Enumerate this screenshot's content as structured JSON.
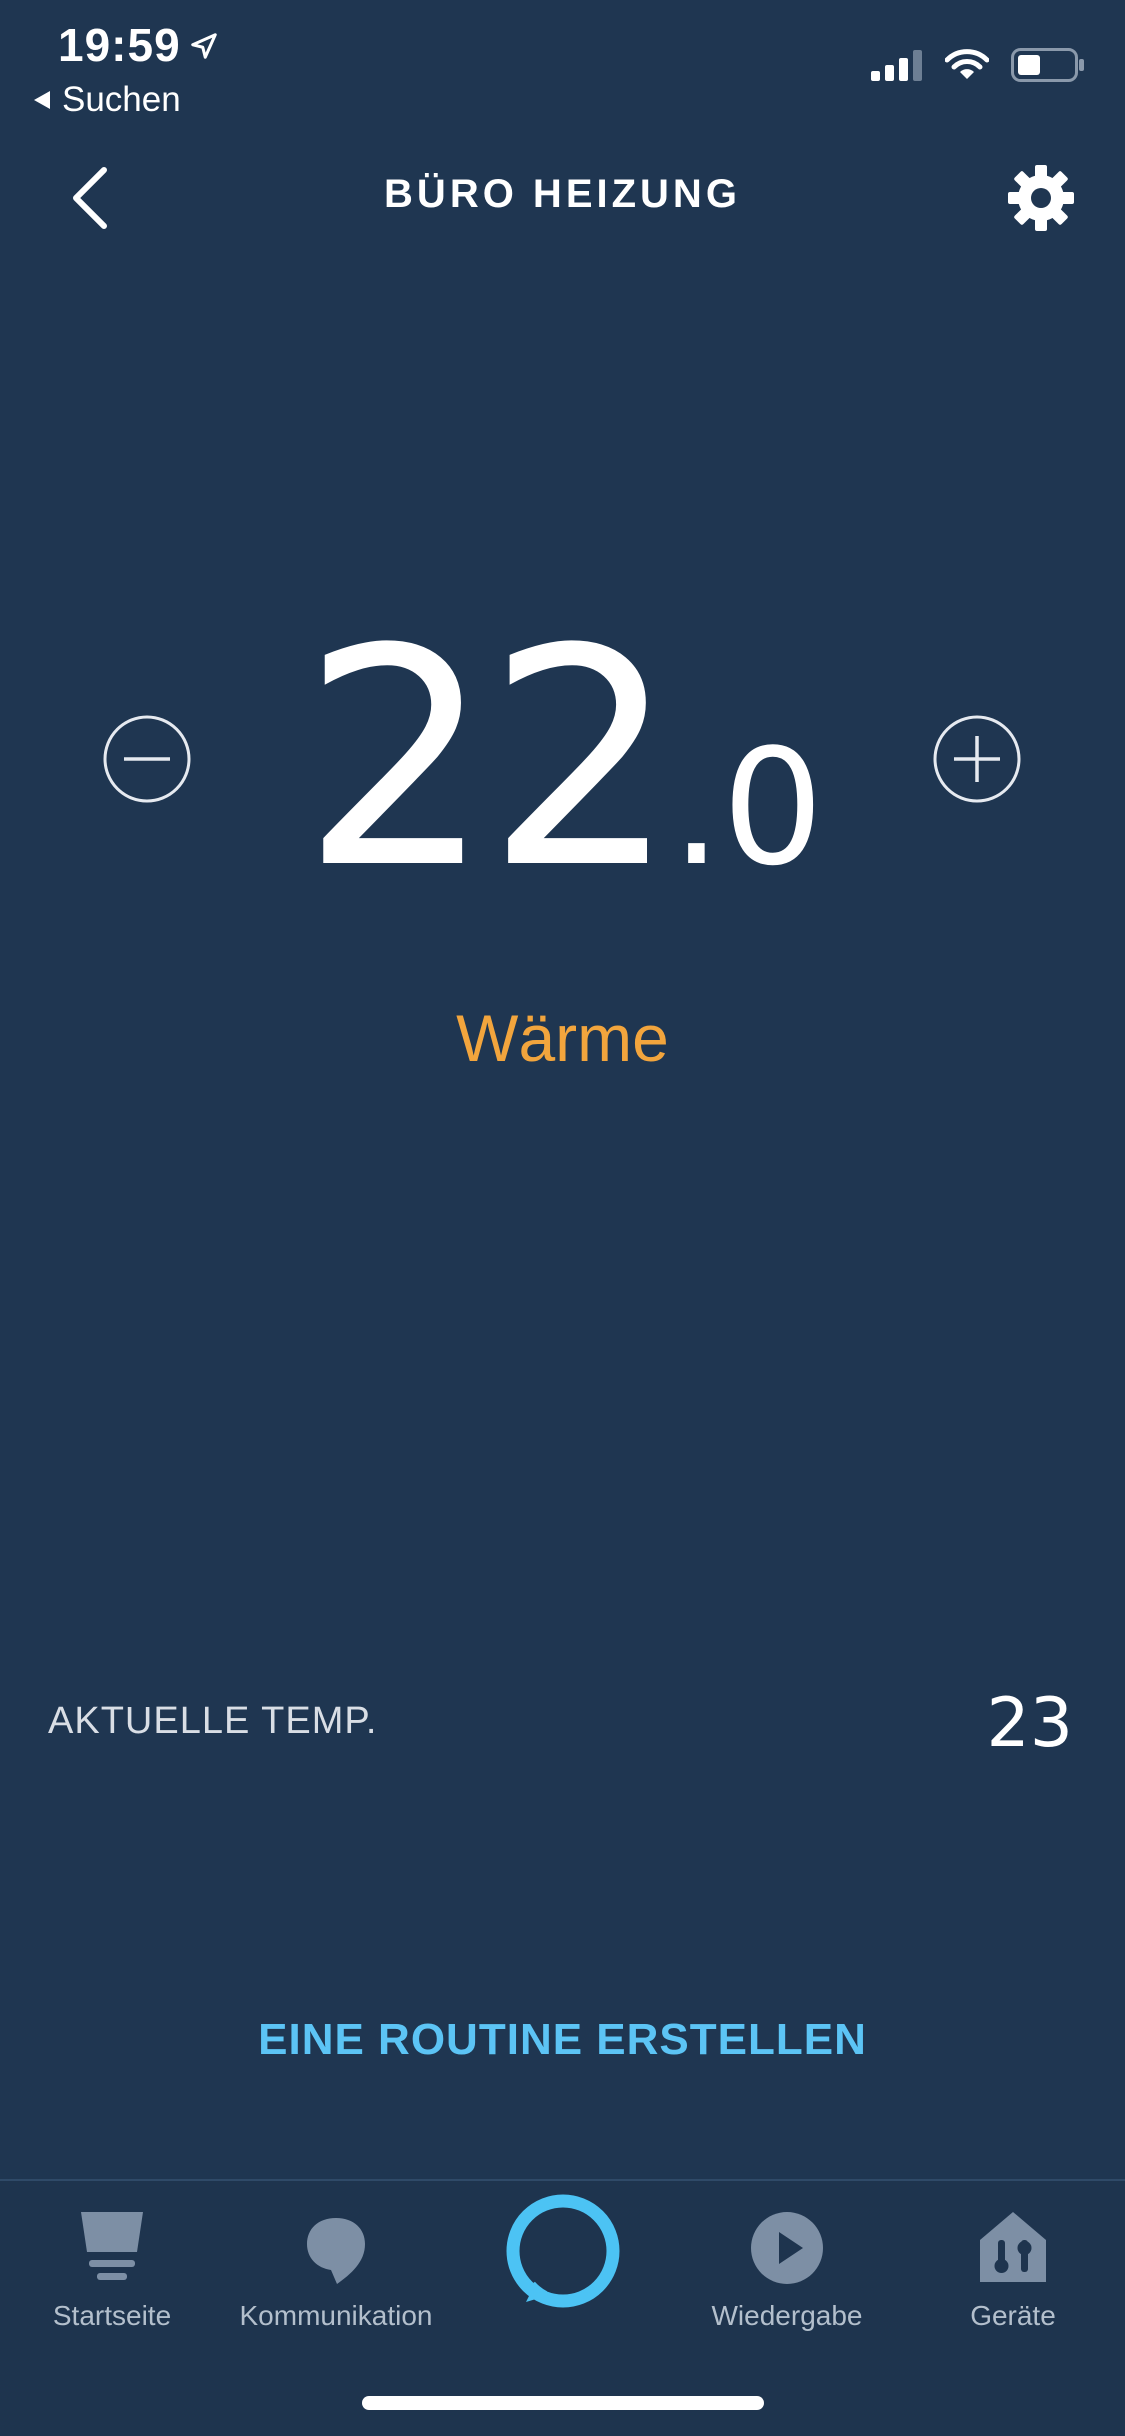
{
  "status_bar": {
    "time": "19:59",
    "back_app": "Suchen"
  },
  "header": {
    "title": "BÜRO HEIZUNG"
  },
  "thermostat": {
    "setpoint_integer": "22",
    "setpoint_decimal": ".0",
    "mode": "Wärme",
    "current_label": "AKTUELLE TEMP.",
    "current_value": "23"
  },
  "routine": {
    "label": "EINE ROUTINE ERSTELLEN"
  },
  "tabbar": {
    "tabs": [
      {
        "label": "Startseite",
        "icon": "home-icon"
      },
      {
        "label": "Kommunikation",
        "icon": "speech-bubble-icon"
      },
      {
        "label": "Alexa",
        "icon": "alexa-ring-icon"
      },
      {
        "label": "Wiedergabe",
        "icon": "play-icon"
      },
      {
        "label": "Geräte",
        "icon": "devices-icon"
      }
    ]
  },
  "colors": {
    "background": "#1f3651",
    "accent_mode": "#f2a53d",
    "link": "#5cc4f5",
    "alexa": "#4cc3f4"
  }
}
